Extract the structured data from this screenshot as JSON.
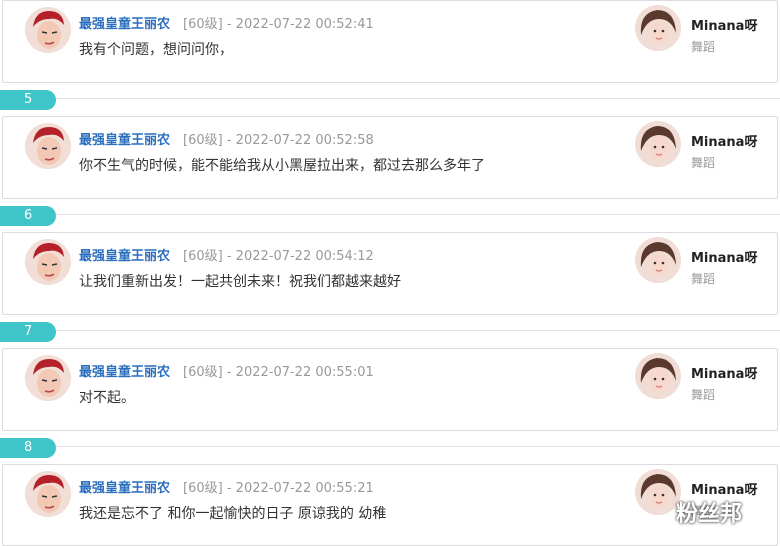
{
  "comments": [
    {
      "author": "最强皇童王丽农",
      "level": "[60级]",
      "sep": "-",
      "time": "2022-07-22 00:52:41",
      "message": "我有个问题，想问问你，",
      "rname": "Minana呀",
      "rtag": "舞蹈"
    },
    {
      "num": "5",
      "author": "最强皇童王丽农",
      "level": "[60级]",
      "sep": "-",
      "time": "2022-07-22 00:52:58",
      "message": "你不生气的时候，能不能给我从小黑屋拉出来，都过去那么多年了",
      "rname": "Minana呀",
      "rtag": "舞蹈"
    },
    {
      "num": "6",
      "author": "最强皇童王丽农",
      "level": "[60级]",
      "sep": "-",
      "time": "2022-07-22 00:54:12",
      "message": "让我们重新出发！一起共创未来！祝我们都越来越好",
      "rname": "Minana呀",
      "rtag": "舞蹈"
    },
    {
      "num": "7",
      "author": "最强皇童王丽农",
      "level": "[60级]",
      "sep": "-",
      "time": "2022-07-22 00:55:01",
      "message": "对不起。",
      "rname": "Minana呀",
      "rtag": "舞蹈"
    },
    {
      "num": "8",
      "author": "最强皇童王丽农",
      "level": "[60级]",
      "sep": "-",
      "time": "2022-07-22 00:55:21",
      "message": "我还是忘不了 和你一起愉快的日子 原谅我的 幼稚",
      "rname": "Minana呀",
      "rtag": "舞蹈"
    }
  ],
  "watermark": "粉丝邦"
}
